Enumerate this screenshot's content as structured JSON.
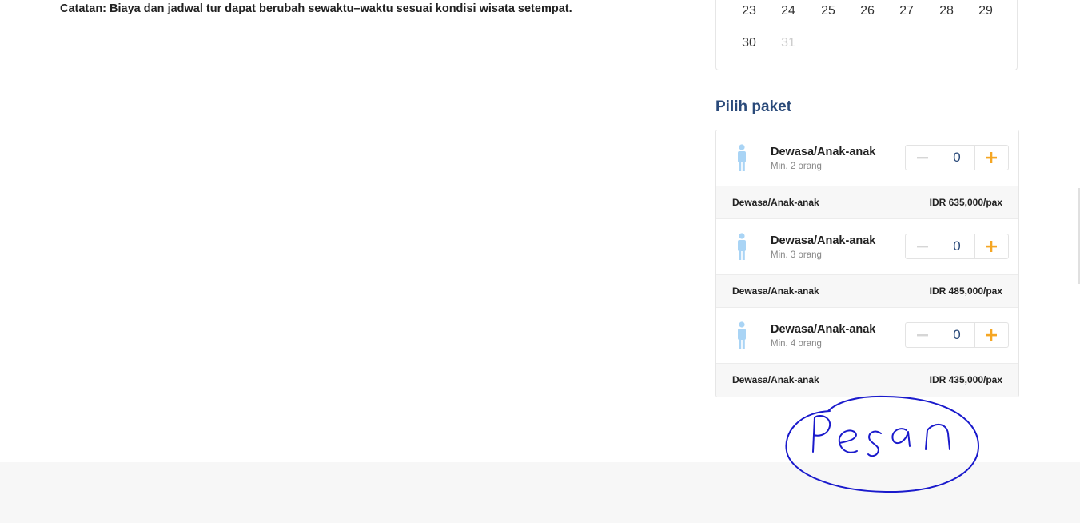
{
  "note": "Catatan: Biaya dan jadwal tur dapat berubah sewaktu–waktu sesuai kondisi wisata setempat.",
  "calendar": {
    "rows": [
      [
        "23",
        "24",
        "25",
        "26",
        "27",
        "28",
        "29"
      ],
      [
        "30",
        "31"
      ]
    ],
    "disabled_days": [
      "31"
    ]
  },
  "packages_section": {
    "title": "Pilih paket",
    "packages": [
      {
        "name": "Dewasa/Anak-anak",
        "min": "Min. 2 orang",
        "quantity": "0",
        "price_label": "Dewasa/Anak-anak",
        "price": "IDR 635,000/pax"
      },
      {
        "name": "Dewasa/Anak-anak",
        "min": "Min. 3 orang",
        "quantity": "0",
        "price_label": "Dewasa/Anak-anak",
        "price": "IDR 485,000/pax"
      },
      {
        "name": "Dewasa/Anak-anak",
        "min": "Min. 4 orang",
        "quantity": "0",
        "price_label": "Dewasa/Anak-anak",
        "price": "IDR 435,000/pax"
      }
    ],
    "icons": {
      "person": "person-icon",
      "minus": "minus-icon",
      "plus": "plus-icon"
    }
  },
  "annotation": {
    "text": "Pesan",
    "icon": "handwritten-circle-annotation"
  },
  "colors": {
    "title": "#2a4a7a",
    "person_icon": "#a9d4f5",
    "plus": "#f5a623",
    "minus_disabled": "#d6d6d6",
    "annotation_ink": "#1a1acc"
  }
}
